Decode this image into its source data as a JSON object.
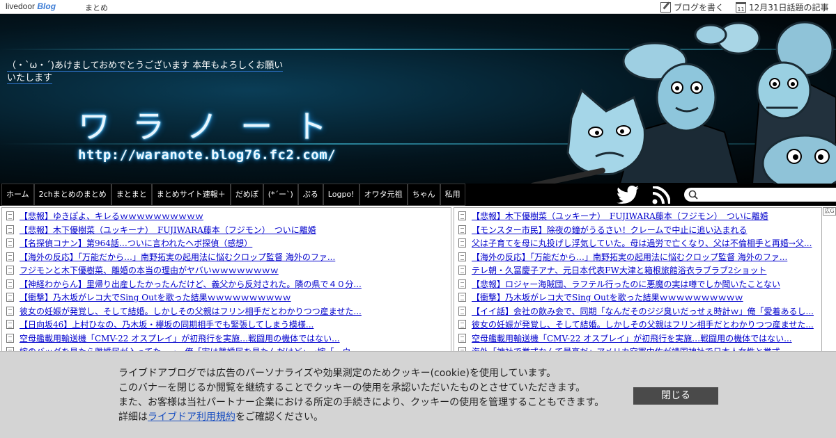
{
  "topbar": {
    "logo_text": "livedoor",
    "logo_blog": "Blog",
    "matome": "まとめ",
    "write_blog": "ブログを書く",
    "today_topics": "12月31日話題の記事",
    "calendar_day": "11"
  },
  "header": {
    "tagline": "（・`ω・´)あけましておめでとうございます 本年もよろしくお願いいたします",
    "title": "ワラノート",
    "url": "http://waranote.blog76.fc2.com/"
  },
  "nav": {
    "items": [
      "ホーム",
      "2chまとめのまとめ",
      "まとまと",
      "まとめサイト速報＋",
      "だめぽ",
      "(*´ー`)",
      "ぷる",
      "Logpo!",
      "オワタ元祖",
      "ちゃん",
      "私用"
    ]
  },
  "left_list": [
    "【悲報】ゆきぽよ、キレるｗｗｗｗｗｗｗｗｗｗ",
    "【悲報】木下優樹菜（ユッキーナ）　FUJIWARA藤本（フジモン）　ついに離婚",
    "【名探偵コナン】第964話…ついに言われたヘボ探偵（感想）",
    "【海外の反応】「万能だから…」南野拓実の起用法に悩むクロップ監督 海外のファ...",
    "フジモンと木下優樹菜、離婚の本当の理由がヤバいｗｗｗｗｗｗｗｗ",
    "【神経わからん】里帰り出産したかったんだけど、義父から反対された。隣の県で４０分...",
    "【衝撃】乃木坂がレコ大でSing Outを歌った結果ｗｗｗｗｗｗｗｗｗｗ",
    "彼女の妊娠が発覚し、そして結婚。しかしその父親はフリン相手だとわかりつつ産ませた...",
    "【日向坂46】上村ひなの、乃木坂・欅坂の同期相手でも緊張してしまう模様...",
    "空母艦載用輸送機「CMV-22 オスプレイ」が初飛行を実施…戦闘用の機体ではない...",
    "嫁のバッグを見たら離婚届が入ってた　→　俺「実は離婚届を見たんだけど」→嫁「　ウ"
  ],
  "right_list": [
    "【悲報】木下優樹菜（ユッキーナ）　FUJIWARA藤本（フジモン）　ついに離婚",
    "【モンスター市民】除夜の鐘がうるさい！クレームで中止に追い込まれる",
    "父は子育てを母に丸投げし浮気していた。母は過労で亡くなり、父は不倫相手と再婚→父...",
    "【海外の反応】「万能だから…」南野拓実の起用法に悩むクロップ監督 海外のファ...",
    "テレ朝・久冨慶子アナ、元日本代表FW大津と箱根旅館浴衣ラブラブ2ショット",
    "【悲報】ロジャー海賊団、ラフテル行ったのに悪魔の実は噂でしか聞いたことない",
    "【衝撃】乃木坂がレコ大でSing Outを歌った結果ｗｗｗｗｗｗｗｗｗｗ",
    "【イイ話】会社の飲み会で、同期「なんだそのジジ臭いだっせぇ時計ｗ」俺「愛着あるし...",
    "彼女の妊娠が発覚し、そして結婚。しかしその父親はフリン相手だとわかりつつ産ませた...",
    "空母艦載用輸送機「CMV-22 オスプレイ」が初飛行を実施…戦闘用の機体ではない...",
    "海外「神社で挙式なんて最高だ」アメリカ空軍中佐が靖国神社で日本人女性と挙式"
  ],
  "ad_mark": "広G",
  "cookie": {
    "line1": "ライブドアブログでは広告のパーソナライズや効果測定のためクッキー(cookie)を使用しています。",
    "line2": "このバナーを閉じるか閲覧を継続することでクッキーの使用を承認いただいたものとさせていただきます。",
    "line3": "また、お客様は当社パートナー企業における所定の手続きにより、クッキーの使用を管理することもできます。",
    "line4_pre": "詳細は",
    "line4_link": "ライブドア利用規約",
    "line4_post": "をご確認ください。",
    "close": "閉じる"
  }
}
